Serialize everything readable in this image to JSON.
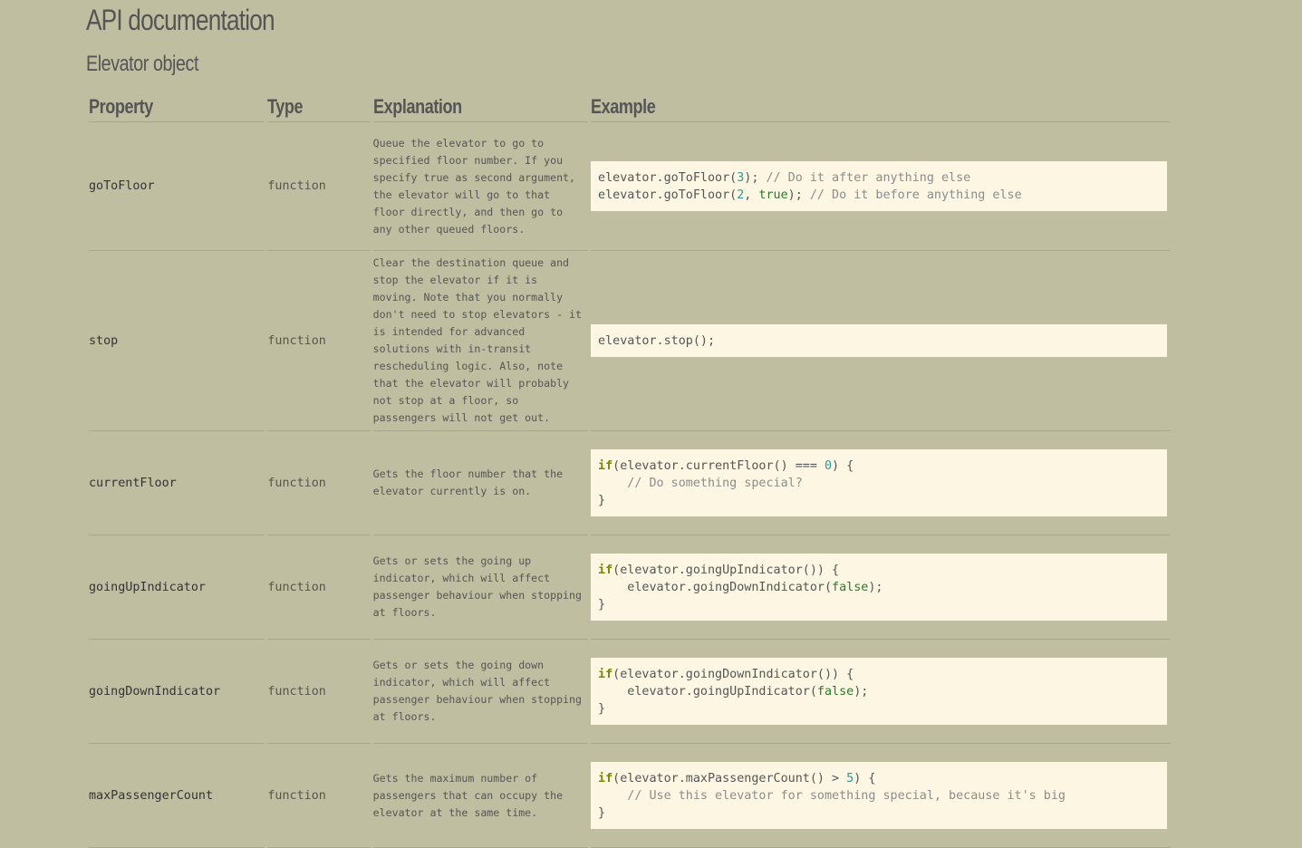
{
  "page": {
    "title": "API documentation",
    "section": "Elevator object"
  },
  "table": {
    "headers": [
      "Property",
      "Type",
      "Explanation",
      "Example"
    ],
    "rows": [
      {
        "property": "goToFloor",
        "type": "function",
        "explanation": "Queue the elevator to go to specified floor number. If you specify true as second argument, the elevator will go to that floor directly, and then go to any other queued floors.",
        "example": [
          [
            [
              "t",
              "elevator.goToFloor("
            ],
            [
              "n",
              "3"
            ],
            [
              "t",
              "); "
            ],
            [
              "c",
              "// Do it after anything else"
            ]
          ],
          [
            [
              "t",
              "elevator.goToFloor("
            ],
            [
              "n",
              "2"
            ],
            [
              "t",
              ", "
            ],
            [
              "b",
              "true"
            ],
            [
              "t",
              "); "
            ],
            [
              "c",
              "// Do it before anything else"
            ]
          ]
        ]
      },
      {
        "property": "stop",
        "type": "function",
        "explanation": "Clear the destination queue and stop the elevator if it is moving. Note that you normally don't need to stop elevators - it is intended for advanced solutions with in-transit rescheduling logic. Also, note that the elevator will probably not stop at a floor, so passengers will not get out.",
        "example": [
          [
            [
              "t",
              "elevator.stop();"
            ]
          ]
        ]
      },
      {
        "property": "currentFloor",
        "type": "function",
        "explanation": "Gets the floor number that the elevator currently is on.",
        "example": [
          [
            [
              "k",
              "if"
            ],
            [
              "t",
              "(elevator.currentFloor() === "
            ],
            [
              "n",
              "0"
            ],
            [
              "t",
              ") {"
            ]
          ],
          [
            [
              "t",
              "    "
            ],
            [
              "c",
              "// Do something special?"
            ]
          ],
          [
            [
              "t",
              "}"
            ]
          ]
        ]
      },
      {
        "property": "goingUpIndicator",
        "type": "function",
        "explanation": "Gets or sets the going up indicator, which will affect passenger behaviour when stopping at floors.",
        "example": [
          [
            [
              "k",
              "if"
            ],
            [
              "t",
              "(elevator.goingUpIndicator()) {"
            ]
          ],
          [
            [
              "t",
              "    elevator.goingDownIndicator("
            ],
            [
              "b",
              "false"
            ],
            [
              "t",
              ");"
            ]
          ],
          [
            [
              "t",
              "}"
            ]
          ]
        ]
      },
      {
        "property": "goingDownIndicator",
        "type": "function",
        "explanation": "Gets or sets the going down indicator, which will affect passenger behaviour when stopping at floors.",
        "example": [
          [
            [
              "k",
              "if"
            ],
            [
              "t",
              "(elevator.goingDownIndicator()) {"
            ]
          ],
          [
            [
              "t",
              "    elevator.goingUpIndicator("
            ],
            [
              "b",
              "false"
            ],
            [
              "t",
              ");"
            ]
          ],
          [
            [
              "t",
              "}"
            ]
          ]
        ]
      },
      {
        "property": "maxPassengerCount",
        "type": "function",
        "explanation": "Gets the maximum number of passengers that can occupy the elevator at the same time.",
        "example": [
          [
            [
              "k",
              "if"
            ],
            [
              "t",
              "(elevator.maxPassengerCount() > "
            ],
            [
              "n",
              "5"
            ],
            [
              "t",
              ") {"
            ]
          ],
          [
            [
              "t",
              "    "
            ],
            [
              "c",
              "// Use this elevator for something special, because it's big"
            ]
          ],
          [
            [
              "t",
              "}"
            ]
          ]
        ]
      }
    ]
  },
  "colors": {
    "background": "#c0bea0",
    "code_background": "#fcf6e3",
    "keyword": "#7a8a00",
    "number": "#2a9a9a",
    "boolean": "#2a7a2a",
    "comment": "#8c8c8c"
  }
}
